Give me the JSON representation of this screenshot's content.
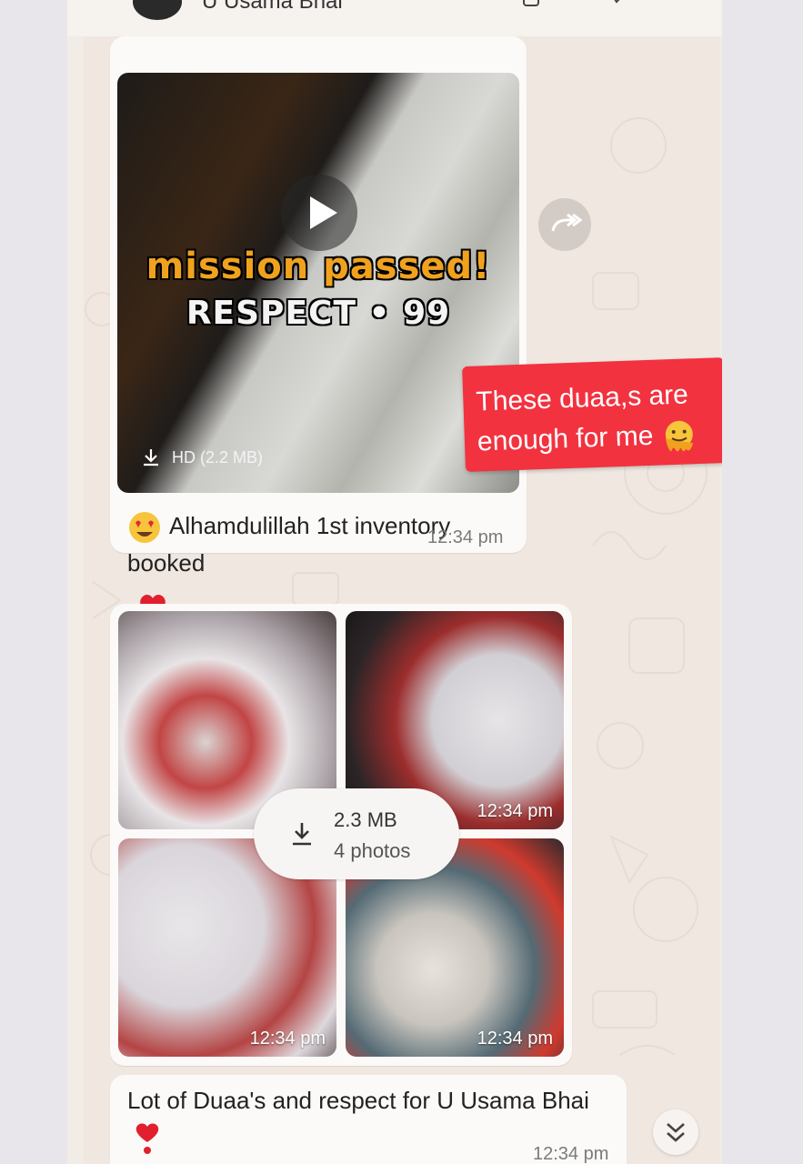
{
  "header": {
    "contact_name": "U Usama Bhai"
  },
  "messages": {
    "video": {
      "overlay_line1": "mission passed!",
      "overlay_line2": "RESPECT • 99",
      "hd_label": "HD (2.2 MB)",
      "sticker_text": "These duaa,s are enough for me",
      "caption": "Alhamdulillah 1st inventory booked",
      "time": "12:34 pm",
      "reaction_icon": "red-heart"
    },
    "photos": {
      "download_size": "2.3 MB",
      "download_count": "4 photos",
      "times": [
        "12:34 pm",
        "12:34 pm",
        "12:34 pm"
      ]
    },
    "text": {
      "caption": "Lot of Duaa's and respect for U Usama Bhai",
      "time": "12:34 pm"
    }
  },
  "colors": {
    "sticker_red": "#f2323f",
    "chat_bg": "#efe7e0",
    "bubble_bg": "#fbfaf8"
  }
}
